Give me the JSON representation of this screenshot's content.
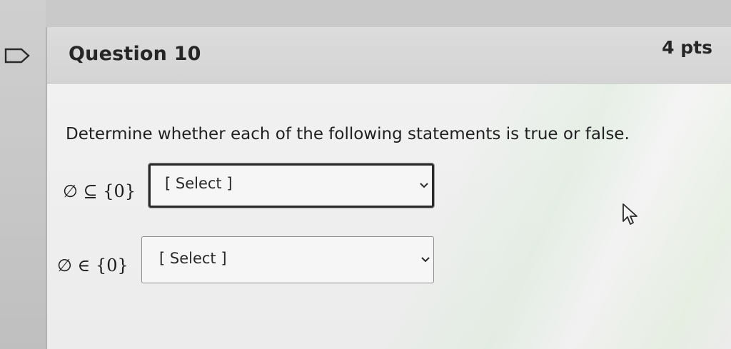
{
  "nav": {
    "flag_icon": "flag-outline-icon"
  },
  "question": {
    "title": "Question 10",
    "points": "4 pts",
    "instructions": "Determine whether each of the following statements is true or false."
  },
  "statements": [
    {
      "text": "∅ ⊆ {0}",
      "select_value": "[ Select ]",
      "focused": true
    },
    {
      "text": "∅ ∈ {0}",
      "select_value": "[ Select ]",
      "focused": false
    }
  ],
  "icons": {
    "dropdown": "chevron-down-icon",
    "pointer": "cursor-icon"
  },
  "colors": {
    "card_background": "#ededed",
    "header_background": "#d8d8d8",
    "text": "#1e1e1e",
    "focused_border": "#2a2a2a"
  }
}
